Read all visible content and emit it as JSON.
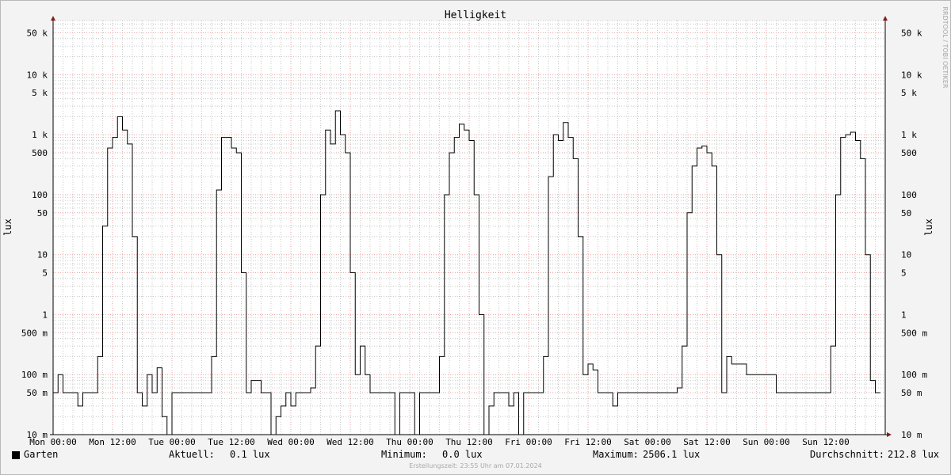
{
  "chart_data": {
    "type": "line",
    "title": "Helligkeit",
    "ylabel_left": "lux",
    "ylabel_right": "lux",
    "y_scale": "log",
    "ylim": [
      0.01,
      80000
    ],
    "x_range": [
      "Mon 00:00",
      "Mon 00:00 (+7 days)"
    ],
    "x_tick_labels": [
      "Mon 00:00",
      "Mon 12:00",
      "Tue 00:00",
      "Tue 12:00",
      "Wed 00:00",
      "Wed 12:00",
      "Thu 00:00",
      "Thu 12:00",
      "Fri 00:00",
      "Fri 12:00",
      "Sat 00:00",
      "Sat 12:00",
      "Sun 00:00",
      "Sun 12:00"
    ],
    "y_ticks": [
      {
        "value": 0.01,
        "label": "10 m"
      },
      {
        "value": 0.05,
        "label": "50 m"
      },
      {
        "value": 0.1,
        "label": "100 m"
      },
      {
        "value": 0.5,
        "label": "500 m"
      },
      {
        "value": 1,
        "label": "1"
      },
      {
        "value": 5,
        "label": "5"
      },
      {
        "value": 10,
        "label": "10"
      },
      {
        "value": 50,
        "label": "50"
      },
      {
        "value": 100,
        "label": "100"
      },
      {
        "value": 500,
        "label": "500"
      },
      {
        "value": 1000,
        "label": "1 k"
      },
      {
        "value": 5000,
        "label": "5 k"
      },
      {
        "value": 10000,
        "label": "10 k"
      },
      {
        "value": 50000,
        "label": "50 k"
      }
    ],
    "grid": true,
    "line_color": "#000000",
    "grid_major_color": "#e8a0a0",
    "grid_minor_color": "#c8c8c8",
    "plot_background": "#ffffff",
    "series": [
      {
        "name": "Garten",
        "hours": [
          0,
          1,
          2,
          3,
          4,
          5,
          6,
          7,
          8,
          9,
          10,
          11,
          12,
          13,
          14,
          15,
          16,
          17,
          18,
          19,
          20,
          21,
          22,
          23,
          24,
          25,
          26,
          27,
          28,
          29,
          30,
          31,
          32,
          33,
          34,
          35,
          36,
          37,
          38,
          39,
          40,
          41,
          42,
          43,
          44,
          45,
          46,
          47,
          48,
          49,
          50,
          51,
          52,
          53,
          54,
          55,
          56,
          57,
          58,
          59,
          60,
          61,
          62,
          63,
          64,
          65,
          66,
          67,
          68,
          69,
          70,
          71,
          72,
          73,
          74,
          75,
          76,
          77,
          78,
          79,
          80,
          81,
          82,
          83,
          84,
          85,
          86,
          87,
          88,
          89,
          90,
          91,
          92,
          93,
          94,
          95,
          96,
          97,
          98,
          99,
          100,
          101,
          102,
          103,
          104,
          105,
          106,
          107,
          108,
          109,
          110,
          111,
          112,
          113,
          114,
          115,
          116,
          117,
          118,
          119,
          120,
          121,
          122,
          123,
          124,
          125,
          126,
          127,
          128,
          129,
          130,
          131,
          132,
          133,
          134,
          135,
          136,
          137,
          138,
          139,
          140,
          141,
          142,
          143,
          144,
          145,
          146,
          147,
          148,
          149,
          150,
          151,
          152,
          153,
          154,
          155,
          156,
          157,
          158,
          159,
          160,
          161,
          162,
          163,
          164,
          165,
          166,
          167
        ],
        "values": [
          0.05,
          0.1,
          0.05,
          0.05,
          0.05,
          0.03,
          0.05,
          0.05,
          0.05,
          0.2,
          30,
          600,
          900,
          2000,
          1200,
          700,
          20,
          0.05,
          0.03,
          0.1,
          0.05,
          0.13,
          0.02,
          0.01,
          0.05,
          0.05,
          0.05,
          0.05,
          0.05,
          0.05,
          0.05,
          0.05,
          0.2,
          120,
          900,
          900,
          600,
          500,
          5,
          0.05,
          0.08,
          0.08,
          0.05,
          0.05,
          0.01,
          0.02,
          0.03,
          0.05,
          0.03,
          0.05,
          0.05,
          0.05,
          0.06,
          0.3,
          100,
          1200,
          700,
          2500,
          1000,
          500,
          5,
          0.1,
          0.3,
          0.1,
          0.05,
          0.05,
          0.05,
          0.05,
          0.05,
          0.01,
          0.05,
          0.05,
          0.05,
          0.01,
          0.05,
          0.05,
          0.05,
          0.05,
          0.2,
          100,
          500,
          900,
          1500,
          1200,
          800,
          100,
          1,
          0.01,
          0.03,
          0.05,
          0.05,
          0.05,
          0.03,
          0.05,
          0.01,
          0.05,
          0.05,
          0.05,
          0.05,
          0.2,
          200,
          1000,
          800,
          1600,
          900,
          400,
          20,
          0.1,
          0.15,
          0.12,
          0.05,
          0.05,
          0.05,
          0.03,
          0.05,
          0.05,
          0.05,
          0.05,
          0.05,
          0.05,
          0.05,
          0.05,
          0.05,
          0.05,
          0.05,
          0.05,
          0.06,
          0.3,
          50,
          300,
          600,
          650,
          500,
          300,
          10,
          0.05,
          0.2,
          0.15,
          0.15,
          0.15,
          0.1,
          0.1,
          0.1,
          0.1,
          0.1,
          0.1,
          0.05,
          0.05,
          0.05,
          0.05,
          0.05,
          0.05,
          0.05,
          0.05,
          0.05,
          0.05,
          0.05,
          0.3,
          100,
          900,
          1000,
          1100,
          800,
          400,
          10,
          0.08,
          0.05,
          0.05,
          0.25,
          0.05,
          0.05,
          0.05,
          0.05,
          0.05
        ]
      }
    ],
    "legend": {
      "series_name": "Garten",
      "stats": [
        {
          "label": "Aktuell:",
          "value": "0.1 lux"
        },
        {
          "label": "Minimum:",
          "value": "0.0 lux"
        },
        {
          "label": "Maximum:",
          "value": "2506.1 lux"
        },
        {
          "label": "Durchschnitt:",
          "value": "212.8 lux"
        }
      ]
    },
    "watermark": "RRDTOOL / TOBI OETIKER",
    "footer": "Erstellungszeit: 23:55 Uhr am 07.01.2024"
  }
}
